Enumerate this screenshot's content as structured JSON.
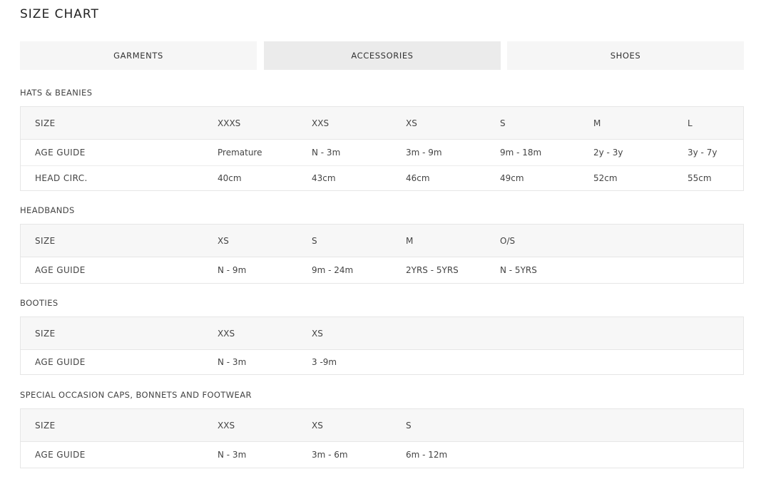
{
  "page": {
    "title": "SIZE CHART"
  },
  "tabs": [
    {
      "label": "GARMENTS",
      "active": false
    },
    {
      "label": "ACCESSORIES",
      "active": true
    },
    {
      "label": "SHOES",
      "active": false
    }
  ],
  "sections": [
    {
      "title": "HATS & BEANIES",
      "header": [
        "SIZE",
        "XXXS",
        "XXS",
        "XS",
        "S",
        "M",
        "L"
      ],
      "rows": [
        [
          "AGE GUIDE",
          "Premature",
          "N - 3m",
          "3m - 9m",
          "9m - 18m",
          "2y - 3y",
          "3y - 7y"
        ],
        [
          "HEAD CIRC.",
          "40cm",
          "43cm",
          "46cm",
          "49cm",
          "52cm",
          "55cm"
        ]
      ]
    },
    {
      "title": "HEADBANDS",
      "header": [
        "SIZE",
        "XS",
        "S",
        "M",
        "O/S"
      ],
      "rows": [
        [
          "AGE GUIDE",
          "N - 9m",
          "9m - 24m",
          "2YRS - 5YRS",
          "N - 5YRS"
        ]
      ]
    },
    {
      "title": "BOOTIES",
      "header": [
        "SIZE",
        "XXS",
        "XS"
      ],
      "rows": [
        [
          "AGE GUIDE",
          "N - 3m",
          "3 -9m"
        ]
      ]
    },
    {
      "title": "SPECIAL OCCASION CAPS, BONNETS AND FOOTWEAR",
      "header": [
        "SIZE",
        "XXS",
        "XS",
        "S"
      ],
      "rows": [
        [
          "AGE GUIDE",
          "N - 3m",
          "3m - 6m",
          "6m - 12m"
        ]
      ]
    }
  ]
}
